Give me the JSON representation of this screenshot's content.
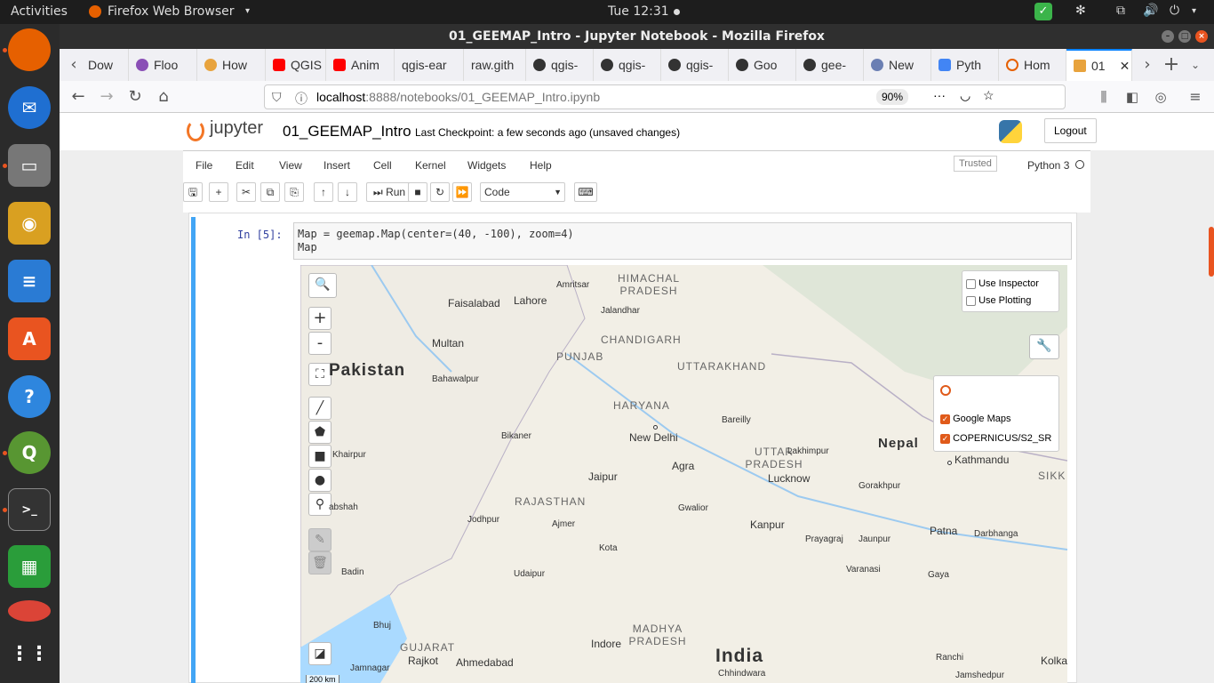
{
  "topbar": {
    "activities": "Activities",
    "app": "Firefox Web Browser",
    "clock": "Tue 12:31"
  },
  "window": {
    "title": "01_GEEMAP_Intro - Jupyter Notebook - Mozilla Firefox"
  },
  "tabs": [
    "Dow",
    "Floo",
    "How",
    "QGIS",
    "Anim",
    "qgis-ear",
    "raw.gith",
    "qgis-",
    "qgis-",
    "qgis-",
    "Goo",
    "gee-",
    "New",
    "Pyth",
    "Hom",
    "01"
  ],
  "url": {
    "host": "localhost",
    "path": ":8888/notebooks/01_GEEMAP_Intro.ipynb",
    "zoom": "90%"
  },
  "jupyter": {
    "logo": "jupyter",
    "name": "01_GEEMAP_Intro",
    "checkpoint": "Last Checkpoint: a few seconds ago",
    "unsaved": "(unsaved changes)",
    "logout": "Logout",
    "trusted": "Trusted",
    "kernel": "Python 3"
  },
  "menu": [
    "File",
    "Edit",
    "View",
    "Insert",
    "Cell",
    "Kernel",
    "Widgets",
    "Help"
  ],
  "toolbar": {
    "run": "Run",
    "celltype": "Code"
  },
  "cell": {
    "prompt": "In [5]:",
    "line1": "Map = geemap.Map(center=(40, -100), zoom=4)",
    "line2": "Map"
  },
  "map": {
    "inspector": "Use Inspector",
    "plotting": "Use Plotting",
    "layers": [
      "Google Maps",
      "COPERNICUS/S2_SR"
    ],
    "scale": "200 km",
    "labels": {
      "pakistan": "Pakistan",
      "india": "India",
      "nepal": "Nepal",
      "punjab": "PUNJAB",
      "himachal": "HIMACHAL PRADESH",
      "haryana": "HARYANA",
      "uttarakhand": "UTTARAKHAND",
      "chandigarh": "CHANDIGARH",
      "rajasthan": "RAJASTHAN",
      "uttarpradesh": "UTTAR PRADESH",
      "madhya": "MADHYA PRADESH",
      "gujarat": "GUJARAT",
      "sikkim": "SIKK",
      "faisalabad": "Faisalabad",
      "lahore": "Lahore",
      "amritsar": "Amritsar",
      "jalandhar": "Jalandhar",
      "multan": "Multan",
      "bahawalpur": "Bahawalpur",
      "newdelhi": "New Delhi",
      "bikaner": "Bikaner",
      "bareilly": "Bareilly",
      "lakhimpur": "Lakhimpur",
      "khairpur": "Khairpur",
      "agra": "Agra",
      "jaipur": "Jaipur",
      "lucknow": "Lucknow",
      "kathmandu": "Kathmandu",
      "gorakhpur": "Gorakhpur",
      "gwalior": "Gwalior",
      "jodhpur": "Jodhpur",
      "ajmer": "Ajmer",
      "kanpur": "Kanpur",
      "prayagraj": "Prayagraj",
      "jaunpur": "Jaunpur",
      "patna": "Patna",
      "darbhanga": "Darbhanga",
      "kota": "Kota",
      "varanasi": "Varanasi",
      "udaipur": "Udaipur",
      "gaya": "Gaya",
      "badin": "Badin",
      "bhuj": "Bhuj",
      "indore": "Indore",
      "rajkot": "Rajkot",
      "ahmedabad": "Ahmedabad",
      "jamnagar": "Jamnagar",
      "ranchi": "Ranchi",
      "chhindwara": "Chhindwara",
      "jamshedpur": "Jamshedpur",
      "kolkata": "Kolka",
      "abshah": "abshah"
    }
  }
}
